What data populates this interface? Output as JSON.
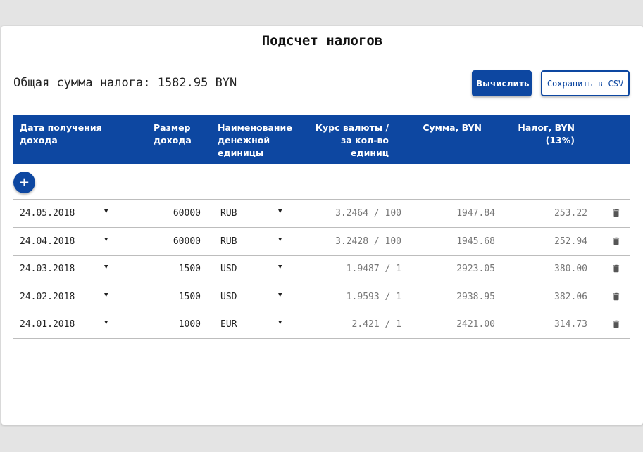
{
  "title": "Подсчет налогов",
  "total_label": "Общая сумма налога: 1582.95 BYN",
  "buttons": {
    "calculate": "Вычислить",
    "save_csv": "Сохранить в CSV"
  },
  "columns": {
    "date": "Дата получения\nдохода",
    "amount": "Размер\nдохода",
    "currency": "Наименование\nденежной\nединицы",
    "rate": "Курс валюты /\nза кол-во\nединиц",
    "sum": "Сумма, BYN",
    "tax": "Налог, BYN\n(13%)"
  },
  "add_icon": "plus-icon",
  "rows": [
    {
      "date": "24.05.2018",
      "amount": "60000",
      "currency": "RUB",
      "rate": "3.2464 / 100",
      "sum": "1947.84",
      "tax": "253.22"
    },
    {
      "date": "24.04.2018",
      "amount": "60000",
      "currency": "RUB",
      "rate": "3.2428 / 100",
      "sum": "1945.68",
      "tax": "252.94"
    },
    {
      "date": "24.03.2018",
      "amount": "1500",
      "currency": "USD",
      "rate": "1.9487 / 1",
      "sum": "2923.05",
      "tax": "380.00"
    },
    {
      "date": "24.02.2018",
      "amount": "1500",
      "currency": "USD",
      "rate": "1.9593 / 1",
      "sum": "2938.95",
      "tax": "382.06"
    },
    {
      "date": "24.01.2018",
      "amount": "1000",
      "currency": "EUR",
      "rate": "2.421 / 1",
      "sum": "2421.00",
      "tax": "314.73"
    }
  ],
  "colors": {
    "accent": "#0d47a1",
    "background": "#e4e4e4",
    "card": "#ffffff",
    "muted_text": "#777777"
  }
}
